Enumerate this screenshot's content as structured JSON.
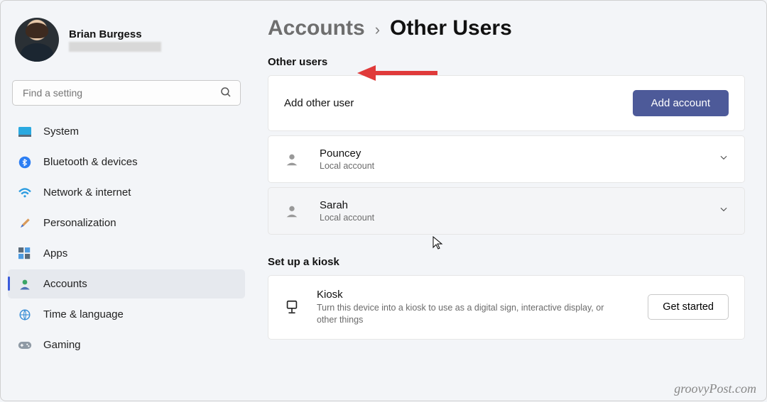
{
  "profile": {
    "name": "Brian Burgess"
  },
  "search": {
    "placeholder": "Find a setting"
  },
  "sidebar": {
    "items": [
      {
        "label": "System"
      },
      {
        "label": "Bluetooth & devices"
      },
      {
        "label": "Network & internet"
      },
      {
        "label": "Personalization"
      },
      {
        "label": "Apps"
      },
      {
        "label": "Accounts"
      },
      {
        "label": "Time & language"
      },
      {
        "label": "Gaming"
      }
    ]
  },
  "breadcrumb": {
    "parent": "Accounts",
    "current": "Other Users"
  },
  "sections": {
    "other_users": {
      "heading": "Other users",
      "add_label": "Add other user",
      "add_button": "Add account",
      "users": [
        {
          "name": "Pouncey",
          "type": "Local account"
        },
        {
          "name": "Sarah",
          "type": "Local account"
        }
      ]
    },
    "kiosk": {
      "heading": "Set up a kiosk",
      "title": "Kiosk",
      "description": "Turn this device into a kiosk to use as a digital sign, interactive display, or other things",
      "button": "Get started"
    }
  },
  "watermark": "groovyPost.com"
}
